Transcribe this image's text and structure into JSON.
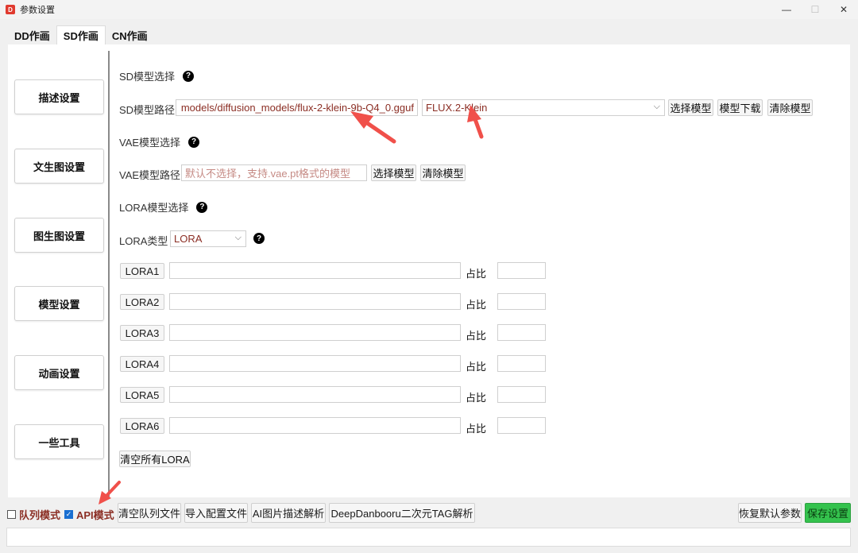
{
  "window": {
    "title": "参数设置",
    "app_icon_letter": "D"
  },
  "tabs": [
    {
      "label": "DD作画"
    },
    {
      "label": "SD作画"
    },
    {
      "label": "CN作画"
    }
  ],
  "sidebar": {
    "items": [
      {
        "label": "描述设置"
      },
      {
        "label": "文生图设置"
      },
      {
        "label": "图生图设置"
      },
      {
        "label": "模型设置"
      },
      {
        "label": "动画设置"
      },
      {
        "label": "一些工具"
      }
    ]
  },
  "sd_model": {
    "section_title": "SD模型选择",
    "path_label": "SD模型路径",
    "path_value": "models/diffusion_models/flux-2-klein-9b-Q4_0.gguf",
    "type_selected": "FLUX.2-Klein",
    "select_button": "选择模型",
    "download_button": "模型下载",
    "clear_button": "清除模型"
  },
  "vae_model": {
    "section_title": "VAE模型选择",
    "path_label": "VAE模型路径",
    "path_placeholder": "默认不选择，支持.vae.pt格式的模型",
    "select_button": "选择模型",
    "clear_button": "清除模型"
  },
  "lora": {
    "section_title": "LORA模型选择",
    "type_label": "LORA类型",
    "type_selected": "LORA",
    "ratio_label": "占比",
    "rows": [
      {
        "label": "LORA1"
      },
      {
        "label": "LORA2"
      },
      {
        "label": "LORA3"
      },
      {
        "label": "LORA4"
      },
      {
        "label": "LORA5"
      },
      {
        "label": "LORA6"
      }
    ],
    "clear_all_button": "清空所有LORA"
  },
  "bottom": {
    "queue_mode_label": "队列模式",
    "queue_mode_checked": false,
    "api_mode_label": "API模式",
    "api_mode_checked": true,
    "clear_queue_button": "清空队列文件",
    "import_config_button": "导入配置文件",
    "ai_parse_button": "AI图片描述解析",
    "deepdanbooru_button": "DeepDanbooru二次元TAG解析",
    "restore_button": "恢复默认参数",
    "save_button": "保存设置"
  },
  "colors": {
    "accent_text": "#8b2e24",
    "save_green": "#34c24d",
    "annotation_arrow": "#f0504a"
  }
}
